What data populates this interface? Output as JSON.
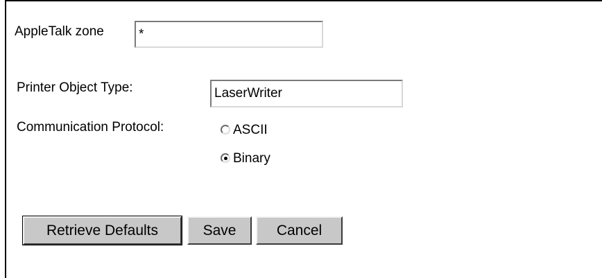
{
  "form": {
    "appletalk_zone": {
      "label": "AppleTalk zone",
      "value": "*"
    },
    "printer_object_type": {
      "label": "Printer Object Type:",
      "value": "LaserWriter"
    },
    "communication_protocol": {
      "label": "Communication Protocol:",
      "options": [
        {
          "label": "ASCII",
          "selected": false
        },
        {
          "label": "Binary",
          "selected": true
        }
      ]
    }
  },
  "buttons": {
    "retrieve_defaults": "Retrieve Defaults",
    "save": "Save",
    "cancel": "Cancel"
  }
}
